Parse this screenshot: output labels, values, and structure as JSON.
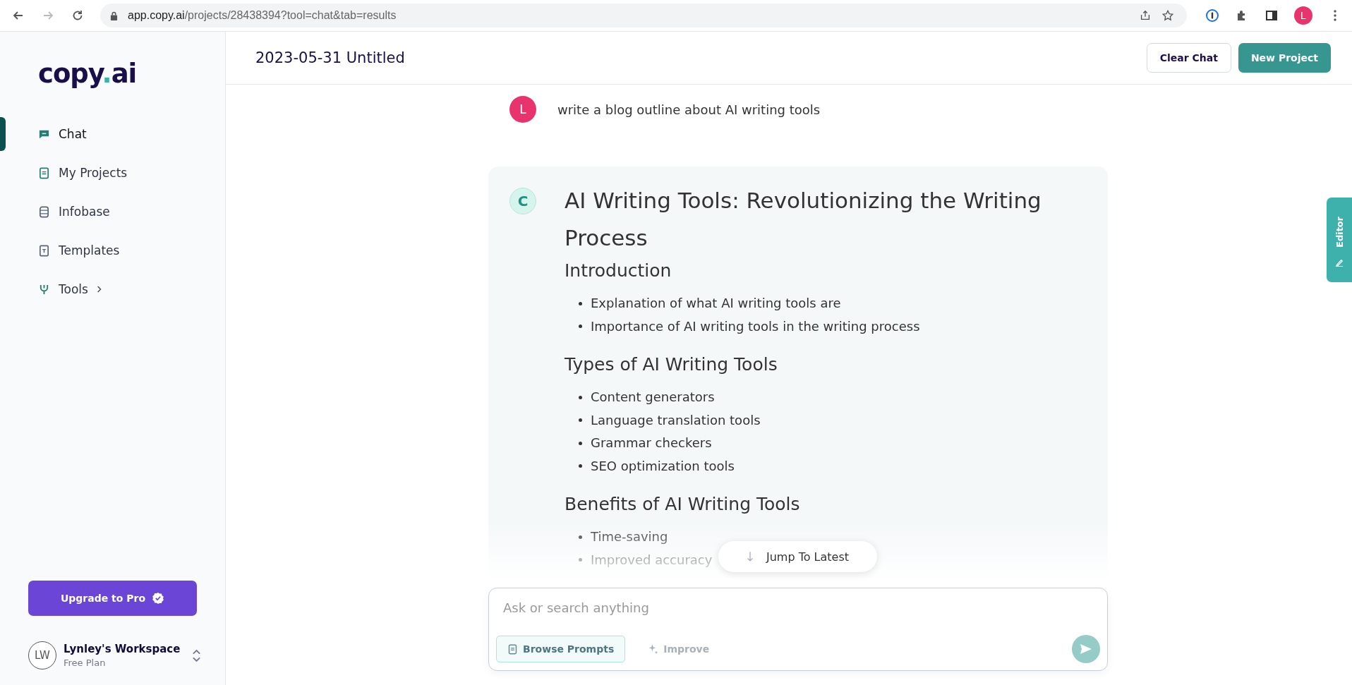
{
  "browser": {
    "url_host": "app.copy.ai",
    "url_path": "/projects/28438394?tool=chat&tab=results",
    "profile_initial": "L"
  },
  "sidebar": {
    "logo_main": "copy",
    "logo_dot": ".",
    "logo_tail": "ai",
    "items": [
      {
        "label": "Chat",
        "selected": true,
        "submenu": false
      },
      {
        "label": "My Projects",
        "selected": false,
        "submenu": false
      },
      {
        "label": "Infobase",
        "selected": false,
        "submenu": false
      },
      {
        "label": "Templates",
        "selected": false,
        "submenu": false
      },
      {
        "label": "Tools",
        "selected": false,
        "submenu": true
      }
    ],
    "upgrade_button": "Upgrade to Pro",
    "workspace": {
      "initials": "LW",
      "name": "Lynley's Workspace",
      "plan": "Free Plan"
    }
  },
  "header": {
    "title": "2023-05-31 Untitled",
    "buttons": [
      {
        "label": "Clear Chat",
        "kind": "secondary"
      },
      {
        "label": "New Project",
        "kind": "primary"
      }
    ]
  },
  "chat": {
    "user_message": {
      "initial": "L",
      "text": "write a blog outline about AI writing tools"
    },
    "reply": {
      "initial": "C",
      "title": "AI Writing Tools: Revolutionizing the Writing Process",
      "sections": [
        {
          "heading": "Introduction",
          "items": [
            "Explanation of what AI writing tools are",
            "Importance of AI writing tools in the writing process"
          ]
        },
        {
          "heading": "Types of AI Writing Tools",
          "items": [
            "Content generators",
            "Language translation tools",
            "Grammar checkers",
            "SEO optimization tools"
          ]
        },
        {
          "heading": "Benefits of AI Writing Tools",
          "items": [
            "Time-saving",
            "Improved accuracy"
          ]
        }
      ]
    },
    "jump_button": "Jump To Latest",
    "composer": {
      "placeholder": "Ask or search anything",
      "browse_button": "Browse Prompts",
      "improve_button": "Improve",
      "improve_disabled": true
    }
  },
  "editor_tab": "Editor"
}
